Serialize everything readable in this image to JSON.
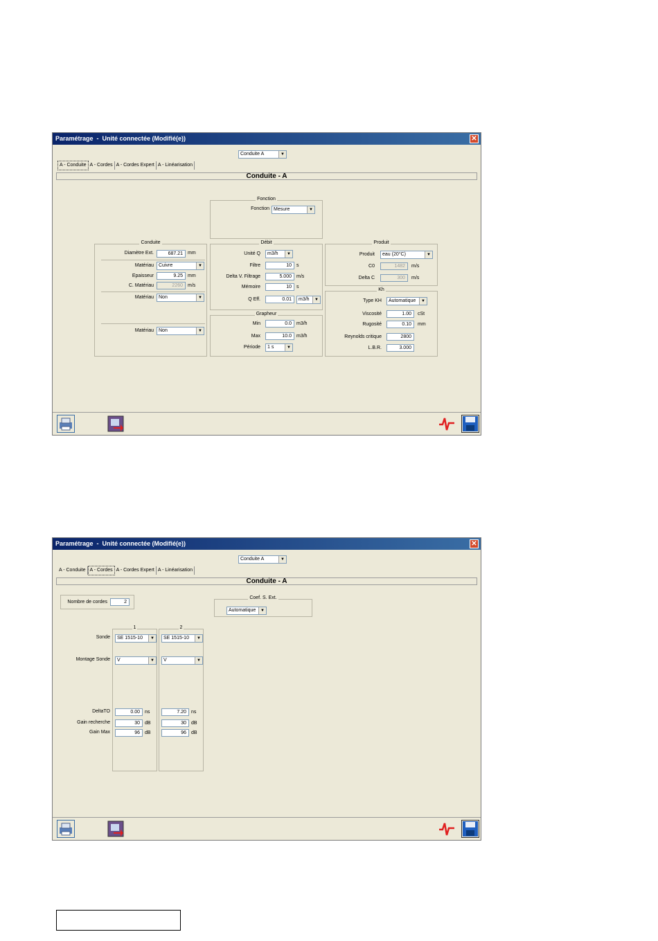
{
  "window_title": "Paramétrage  -  Unité connectée (Modifié(e))",
  "close_glyph": "✕",
  "conduit_select": "Conduite A",
  "tabs": [
    "A - Conduite",
    "A - Cordes",
    "A - Cordes Expert",
    "A - Linéarisation"
  ],
  "section_title": "Conduite - A",
  "window1": {
    "active_tab": 0,
    "fonction": {
      "group_title": "Fonction",
      "label": "Fonction",
      "value": "Mesure"
    },
    "conduite": {
      "group_title": "Conduite",
      "diametre_label": "Diamètre Ext.",
      "diametre_value": "687.21",
      "diametre_unit": "mm",
      "materiau1_label": "Matériau",
      "materiau1_value": "Cuivre",
      "epaisseur_label": "Epaisseur",
      "epaisseur_value": "9.25",
      "epaisseur_unit": "mm",
      "cmat_label": "C. Matériau",
      "cmat_value": "2260",
      "cmat_unit": "m/s",
      "materiau2_label": "Matériau",
      "materiau2_value": "Non",
      "materiau3_label": "Matériau",
      "materiau3_value": "Non"
    },
    "debit": {
      "group_title": "Débit",
      "unite_label": "Unité Q",
      "unite_value": "m3/h",
      "filtre_label": "Filtre",
      "filtre_value": "10",
      "filtre_unit": "s",
      "deltav_label": "Delta V. Filtrage",
      "deltav_value": "5.000",
      "deltav_unit": "m/s",
      "memoire_label": "Mémoire",
      "memoire_value": "10",
      "memoire_unit": "s",
      "qeff_label": "Q Eff.",
      "qeff_value": "0.01",
      "qeff_unit": "m3/h"
    },
    "grapheur": {
      "group_title": "Grapheur",
      "min_label": "Min",
      "min_value": "0.0",
      "min_unit": "m3/h",
      "max_label": "Max",
      "max_value": "10.0",
      "max_unit": "m3/h",
      "periode_label": "Période",
      "periode_value": "1 s"
    },
    "produit": {
      "group_title": "Produit",
      "produit_label": "Produit",
      "produit_value": "eau (20°C)",
      "c0_label": "C0",
      "c0_value": "1482",
      "c0_unit": "m/s",
      "deltac_label": "Delta C",
      "deltac_value": "300",
      "deltac_unit": "m/s"
    },
    "kh": {
      "group_title": "Kh",
      "type_label": "Type KH",
      "type_value": "Automatique",
      "visc_label": "Viscosité",
      "visc_value": "1.00",
      "visc_unit": "cSt",
      "rug_label": "Rugosité",
      "rug_value": "0.10",
      "rug_unit": "mm",
      "rey_label": "Reynolds critique",
      "rey_value": "2800",
      "lbr_label": "L.B.R.",
      "lbr_value": "3.000"
    }
  },
  "window2": {
    "active_tab": 1,
    "nb_cordes_label": "Nombre de cordes",
    "nb_cordes_value": "2",
    "coef_group_title": "Coef. S. Ext.",
    "coef_value": "Automatique",
    "row_labels": {
      "sonde": "Sonde",
      "montage": "Montage Sonde",
      "deltato": "DeltaTO",
      "gain_recherche": "Gain recherche",
      "gain_max": "Gain Max"
    },
    "cordes": [
      {
        "title": "1",
        "sonde": "SE 1515-10",
        "montage": "V",
        "deltato": "0.00",
        "deltato_unit": "ns",
        "gain_recherche": "30",
        "gain_recherche_unit": "dB",
        "gain_max": "96",
        "gain_max_unit": "dB"
      },
      {
        "title": "2",
        "sonde": "SE 1515-10",
        "montage": "V",
        "deltato": "7.20",
        "deltato_unit": "ns",
        "gain_recherche": "30",
        "gain_recherche_unit": "dB",
        "gain_max": "96",
        "gain_max_unit": "dB"
      }
    ]
  },
  "toolbar_icons": [
    "printer-icon",
    "exit-icon",
    "graph-icon",
    "save-icon"
  ],
  "colors": {
    "titlebar": "#0a246a",
    "window_bg": "#ece9d8",
    "close": "#d34a2c",
    "graph": "#e02020",
    "save": "#1f5fbf"
  }
}
